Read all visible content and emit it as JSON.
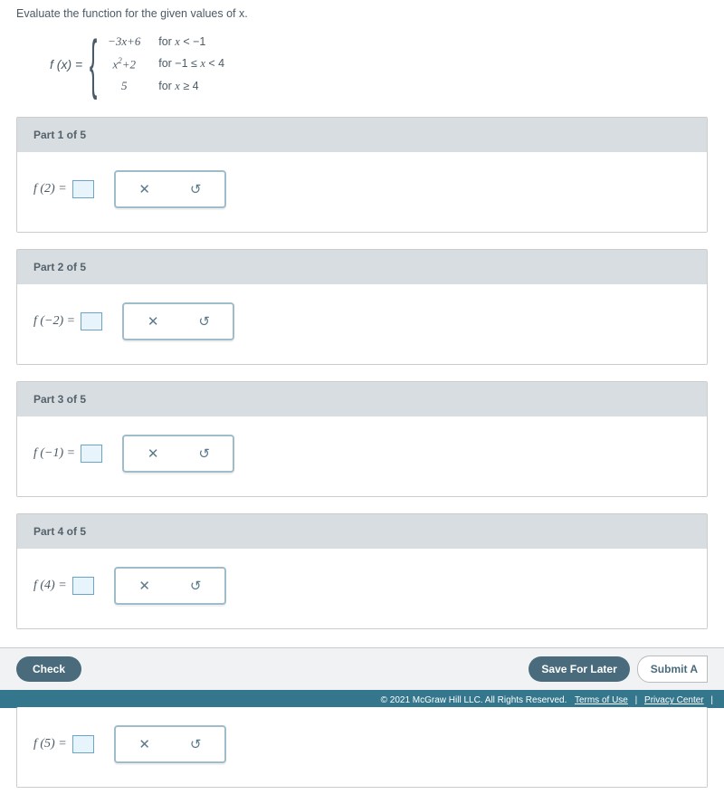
{
  "prompt": "Evaluate the function for the given values of x.",
  "fn_label": "f (x) = ",
  "piecewise": {
    "rows": [
      {
        "expr_html": "−3<span class='ital'>x</span>+6",
        "cond_html": "for <span class='ital'>x</span> < −1"
      },
      {
        "expr_html": "<span class='ital'>x</span><span class='sup'>2</span>+2",
        "cond_html": "for −1 ≤ <span class='ital'>x</span> < 4"
      },
      {
        "expr_html": "5",
        "cond_html": "for <span class='ital'>x</span> ≥ 4"
      }
    ]
  },
  "parts": [
    {
      "header": "Part 1 of 5",
      "label": "f (2) = "
    },
    {
      "header": "Part 2 of 5",
      "label": "f (−2) = "
    },
    {
      "header": "Part 3 of 5",
      "label": "f (−1) = "
    },
    {
      "header": "Part 4 of 5",
      "label": "f (4) = "
    }
  ],
  "trailing_part": {
    "label": "f (5) = "
  },
  "toolbar": {
    "clear_glyph": "✕",
    "reset_glyph": "↺"
  },
  "footer": {
    "check": "Check",
    "save": "Save For Later",
    "submit": "Submit A",
    "copyright": "© 2021 McGraw Hill LLC. All Rights Reserved.",
    "terms": "Terms of Use",
    "privacy": "Privacy Center"
  }
}
